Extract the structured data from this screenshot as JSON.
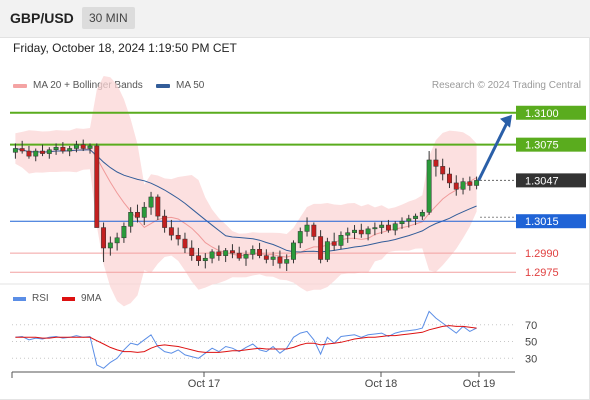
{
  "header": {
    "symbol": "GBP/USD",
    "timeframe": "30 MIN"
  },
  "datetime": "Friday, October 18, 2024 1:19:50 PM CET",
  "credit": "Research © 2024 Trading Central",
  "legend": {
    "ma20": {
      "label": "MA 20 + Bollinger Bands",
      "color": "#f4a3a3"
    },
    "ma50": {
      "label": "MA 50",
      "color": "#335d99"
    }
  },
  "rsi_legend": {
    "rsi": {
      "label": "RSI",
      "color": "#5b8ee6"
    },
    "ma9": {
      "label": "9MA",
      "color": "#dd1111"
    }
  },
  "chart_data": [
    {
      "type": "candlestick",
      "title": "GBP/USD",
      "timeframe": "30 MIN",
      "x_labels": [
        "Oct 17",
        "Oct 18",
        "Oct 19"
      ],
      "ylim": [
        1.2965,
        1.311
      ],
      "price_levels": [
        {
          "value": 1.31,
          "label": "1.3100",
          "style": "resistance",
          "color": "#5aac1e"
        },
        {
          "value": 1.3075,
          "label": "1.3075",
          "style": "resistance",
          "color": "#5aac1e"
        },
        {
          "value": 1.3047,
          "label": "1.3047",
          "style": "current",
          "color": "#333333"
        },
        {
          "value": 1.3015,
          "label": "1.3015",
          "style": "pivot",
          "color": "#1f63d6"
        },
        {
          "value": 1.299,
          "label": "1.2990",
          "style": "support",
          "color": "#e04040"
        },
        {
          "value": 1.2975,
          "label": "1.2975",
          "style": "support",
          "color": "#e04040"
        }
      ],
      "forecast_arrow": {
        "from": 1.3047,
        "to": 1.31
      },
      "series": [
        {
          "name": "MA 20 + Bollinger Bands",
          "color": "#f4a3a3"
        },
        {
          "name": "MA 50",
          "color": "#335d99"
        }
      ],
      "candles": [
        [
          1.3069,
          1.3076,
          1.3064,
          1.3072
        ],
        [
          1.3072,
          1.3078,
          1.3068,
          1.307
        ],
        [
          1.307,
          1.3074,
          1.3064,
          1.3066
        ],
        [
          1.3066,
          1.3072,
          1.3062,
          1.307
        ],
        [
          1.307,
          1.3075,
          1.3066,
          1.3068
        ],
        [
          1.3068,
          1.3073,
          1.3064,
          1.3071
        ],
        [
          1.3071,
          1.3076,
          1.3067,
          1.3073
        ],
        [
          1.3073,
          1.3077,
          1.3068,
          1.307
        ],
        [
          1.307,
          1.3074,
          1.3066,
          1.3072
        ],
        [
          1.3072,
          1.3078,
          1.3069,
          1.3075
        ],
        [
          1.3075,
          1.3079,
          1.307,
          1.3072
        ],
        [
          1.3072,
          1.3076,
          1.3068,
          1.3074
        ],
        [
          1.3074,
          1.3076,
          1.301,
          1.301
        ],
        [
          1.301,
          1.3014,
          1.2983,
          1.2994
        ],
        [
          1.2994,
          1.3003,
          1.2988,
          1.2998
        ],
        [
          1.2998,
          1.3006,
          1.2992,
          1.3002
        ],
        [
          1.3002,
          1.3014,
          1.2998,
          1.3011
        ],
        [
          1.3011,
          1.3026,
          1.3006,
          1.3022
        ],
        [
          1.3022,
          1.3028,
          1.3014,
          1.3018
        ],
        [
          1.3018,
          1.303,
          1.3012,
          1.3026
        ],
        [
          1.3026,
          1.3038,
          1.302,
          1.3034
        ],
        [
          1.3034,
          1.3036,
          1.3016,
          1.3019
        ],
        [
          1.3019,
          1.3024,
          1.3006,
          1.301
        ],
        [
          1.301,
          1.3016,
          1.3,
          1.3004
        ],
        [
          1.3004,
          1.301,
          1.2996,
          1.3001
        ],
        [
          1.3001,
          1.3006,
          1.299,
          1.2994
        ],
        [
          1.2994,
          1.3,
          1.2984,
          1.2988
        ],
        [
          1.2988,
          1.2994,
          1.298,
          1.2984
        ],
        [
          1.2984,
          1.299,
          1.2978,
          1.2986
        ],
        [
          1.2986,
          1.2993,
          1.2982,
          1.2991
        ],
        [
          1.2991,
          1.2996,
          1.2984,
          1.2988
        ],
        [
          1.2988,
          1.2994,
          1.2983,
          1.2992
        ],
        [
          1.2992,
          1.2997,
          1.2986,
          1.299
        ],
        [
          1.299,
          1.2995,
          1.2984,
          1.2986
        ],
        [
          1.2986,
          1.2992,
          1.298,
          1.2989
        ],
        [
          1.2989,
          1.2996,
          1.2985,
          1.2993
        ],
        [
          1.2993,
          1.2998,
          1.2986,
          1.2988
        ],
        [
          1.2988,
          1.2993,
          1.2982,
          1.2985
        ],
        [
          1.2985,
          1.2991,
          1.298,
          1.2987
        ],
        [
          1.2987,
          1.2992,
          1.2978,
          1.2982
        ],
        [
          1.2982,
          1.2989,
          1.2976,
          1.2985
        ],
        [
          1.2985,
          1.3,
          1.2982,
          1.2998
        ],
        [
          1.2998,
          1.301,
          1.2994,
          1.3007
        ],
        [
          1.3007,
          1.3018,
          1.3003,
          1.3012
        ],
        [
          1.3012,
          1.3014,
          1.3,
          1.3003
        ],
        [
          1.3003,
          1.3008,
          1.2982,
          1.2985
        ],
        [
          1.2985,
          1.3002,
          1.2983,
          1.2999
        ],
        [
          1.2999,
          1.3006,
          1.2992,
          1.2996
        ],
        [
          1.2996,
          1.3007,
          1.2993,
          1.3004
        ],
        [
          1.3004,
          1.301,
          1.2998,
          1.3006
        ],
        [
          1.3006,
          1.3012,
          1.3001,
          1.3008
        ],
        [
          1.3008,
          1.3013,
          1.3002,
          1.3005
        ],
        [
          1.3005,
          1.3011,
          1.3,
          1.3009
        ],
        [
          1.3009,
          1.3014,
          1.3004,
          1.301
        ],
        [
          1.301,
          1.3015,
          1.3005,
          1.3012
        ],
        [
          1.3012,
          1.3016,
          1.3006,
          1.3008
        ],
        [
          1.3008,
          1.3015,
          1.3004,
          1.3013
        ],
        [
          1.3013,
          1.3018,
          1.3009,
          1.3015
        ],
        [
          1.3015,
          1.302,
          1.301,
          1.3017
        ],
        [
          1.3017,
          1.3021,
          1.3012,
          1.3019
        ],
        [
          1.3019,
          1.3024,
          1.3016,
          1.3022
        ],
        [
          1.3022,
          1.307,
          1.302,
          1.3063
        ],
        [
          1.3063,
          1.3072,
          1.305,
          1.3058
        ],
        [
          1.3058,
          1.3064,
          1.3047,
          1.3052
        ],
        [
          1.3052,
          1.3057,
          1.3041,
          1.3045
        ],
        [
          1.3045,
          1.3051,
          1.3035,
          1.304
        ],
        [
          1.304,
          1.3049,
          1.3036,
          1.3046
        ],
        [
          1.3046,
          1.305,
          1.3039,
          1.3043
        ],
        [
          1.3043,
          1.305,
          1.304,
          1.3047
        ]
      ]
    },
    {
      "type": "line",
      "title": "RSI",
      "yticks": [
        70,
        50,
        30
      ],
      "ylim": [
        10,
        90
      ],
      "series": [
        {
          "name": "RSI",
          "color": "#5b8ee6"
        },
        {
          "name": "9MA",
          "color": "#dd1111"
        }
      ],
      "rsi": [
        55,
        56,
        52,
        54,
        53,
        55,
        56,
        54,
        55,
        57,
        55,
        56,
        22,
        18,
        25,
        30,
        40,
        48,
        46,
        52,
        58,
        44,
        38,
        36,
        40,
        34,
        32,
        30,
        36,
        42,
        38,
        44,
        42,
        38,
        43,
        47,
        40,
        38,
        44,
        36,
        42,
        55,
        60,
        62,
        52,
        35,
        55,
        48,
        56,
        57,
        58,
        55,
        58,
        59,
        60,
        56,
        60,
        62,
        63,
        64,
        66,
        86,
        78,
        72,
        66,
        60,
        68,
        62,
        66
      ],
      "ma9": [
        55,
        55,
        55,
        55,
        54,
        54,
        55,
        55,
        55,
        55,
        55,
        55,
        51,
        47,
        43,
        40,
        38,
        38,
        37,
        38,
        42,
        45,
        46,
        45,
        44,
        42,
        40,
        38,
        37,
        37,
        37,
        38,
        39,
        39,
        40,
        41,
        42,
        41,
        41,
        41,
        41,
        43,
        46,
        48,
        48,
        46,
        47,
        48,
        49,
        51,
        53,
        54,
        55,
        55,
        56,
        57,
        57,
        58,
        59,
        60,
        61,
        64,
        66,
        68,
        69,
        68,
        68,
        67,
        66
      ]
    }
  ]
}
